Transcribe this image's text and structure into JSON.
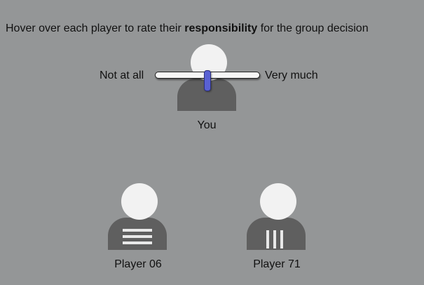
{
  "instruction": {
    "prefix": "Hover over each player to rate their ",
    "emphasis": "responsibility",
    "suffix": " for the group decision"
  },
  "slider": {
    "min_label": "Not at all",
    "max_label": "Very much",
    "value_fraction": 0.5
  },
  "players": {
    "you": {
      "label": "You"
    },
    "p06": {
      "label": "Player 06",
      "shirt_pattern": "horizontal-stripes"
    },
    "p71": {
      "label": "Player 71",
      "shirt_pattern": "vertical-stripes"
    }
  },
  "colors": {
    "background": "#949697",
    "avatar_head": "#f2f2f2",
    "avatar_body": "#5f5f5f",
    "slider_thumb": "#5961d3"
  }
}
